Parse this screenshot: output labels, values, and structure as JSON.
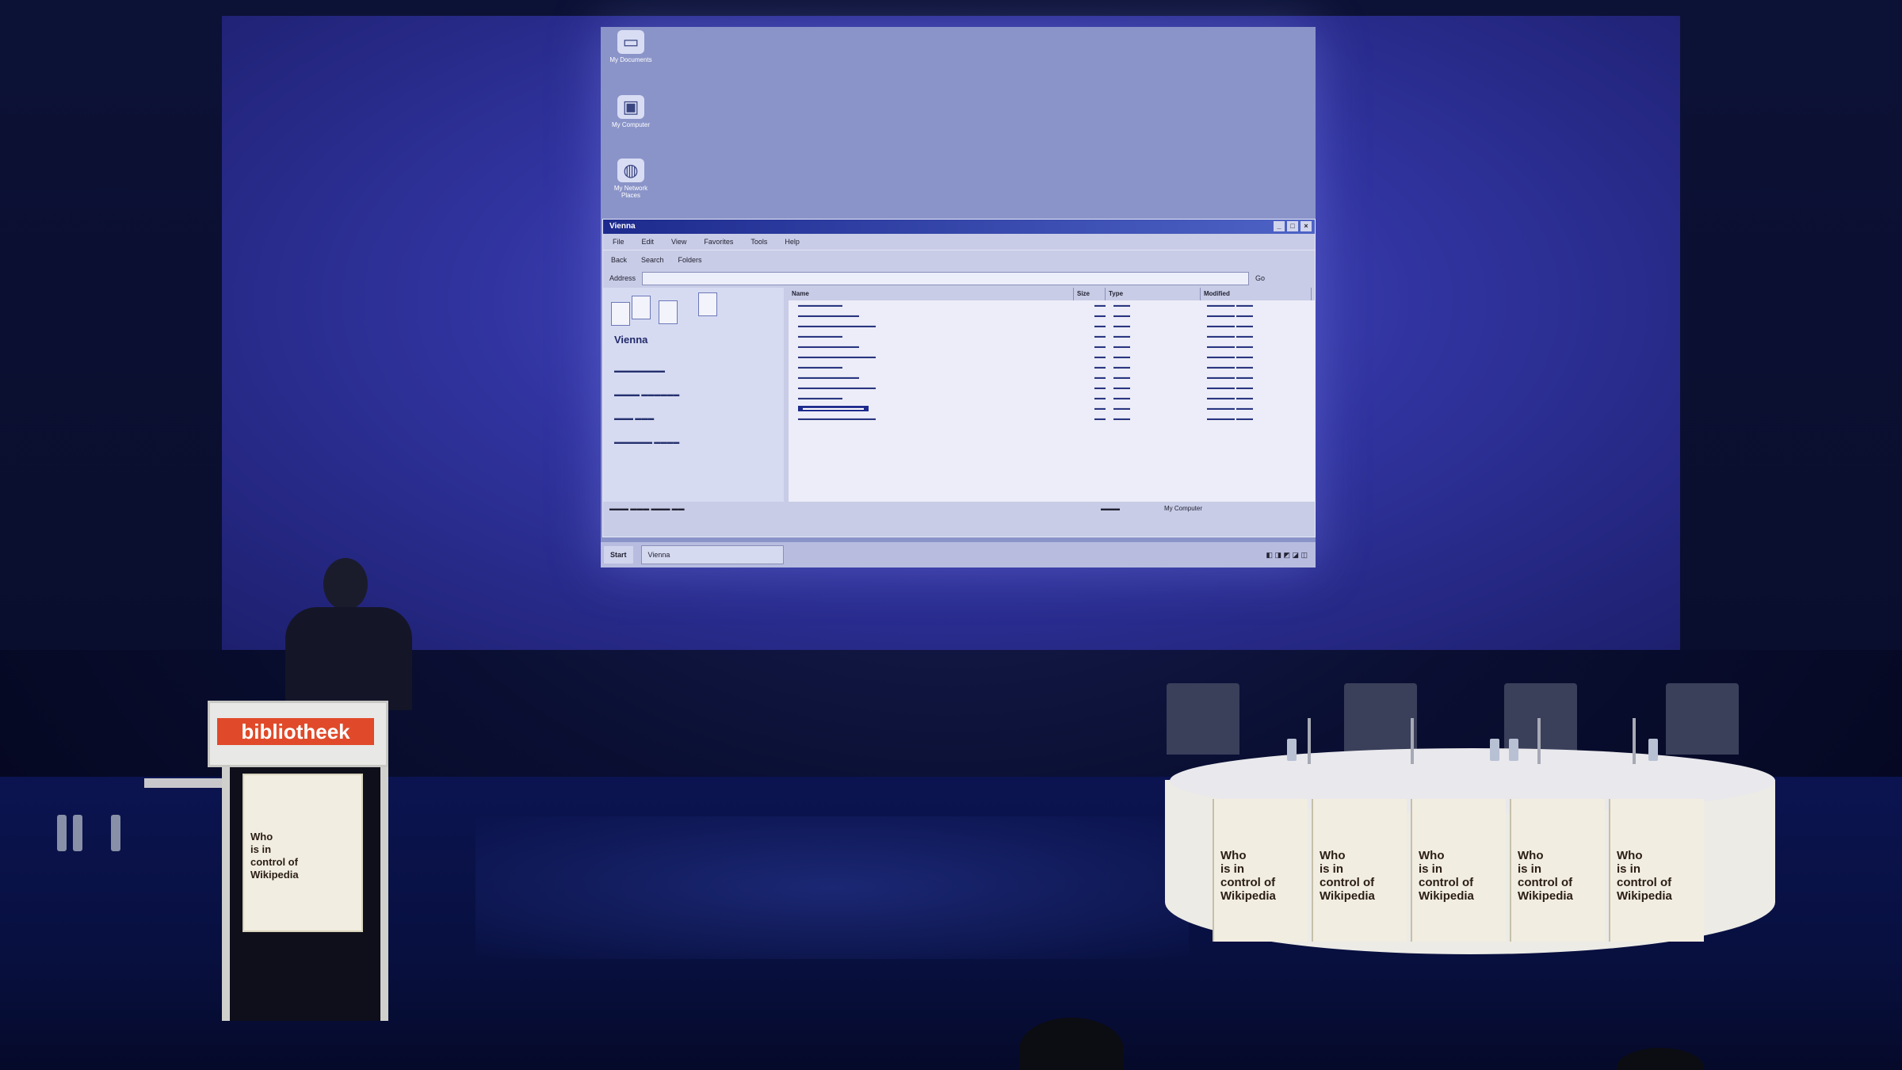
{
  "lectern": {
    "sign": "bibliotheek",
    "poster_lines": [
      "Who",
      "is in",
      "control of",
      "Wikipedia"
    ]
  },
  "table_posters": {
    "lines": [
      "Who",
      "is in",
      "control of",
      "Wikipedia"
    ]
  },
  "screen": {
    "desktop_icons": [
      "My Documents",
      "My Computer",
      "My Network Places"
    ],
    "window": {
      "title": "Vienna",
      "menu": [
        "File",
        "Edit",
        "View",
        "Favorites",
        "Tools",
        "Help"
      ],
      "toolbar": [
        "Back",
        "Search",
        "Folders"
      ],
      "address_label": "Address",
      "go_label": "Go",
      "left_pane_title": "Vienna",
      "columns": [
        "Name",
        "Size",
        "Type",
        "Modified"
      ],
      "file_rows": 12,
      "selected_row": 10,
      "status_right": "My Computer"
    },
    "taskbar": {
      "start": "Start",
      "task": "Vienna"
    }
  },
  "colors": {
    "projection": "#3134a0",
    "sign_red": "#e04a2a",
    "titlebar": "#1d2a8e"
  }
}
